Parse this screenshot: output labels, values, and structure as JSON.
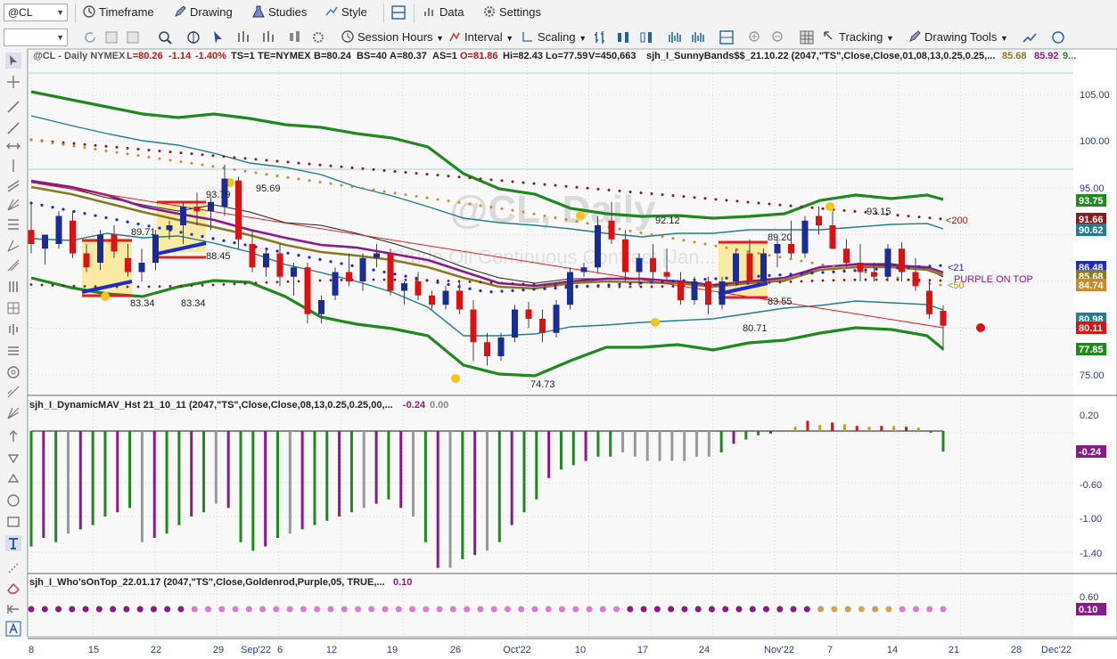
{
  "toolbar1": {
    "symbol": "@CL",
    "timeframe": "Timeframe",
    "drawing": "Drawing",
    "studies": "Studies",
    "style": "Style",
    "data": "Data",
    "settings": "Settings"
  },
  "toolbar2": {
    "session_hours": "Session Hours",
    "interval": "Interval",
    "scaling": "Scaling",
    "tracking": "Tracking",
    "drawing_tools": "Drawing Tools"
  },
  "chart_header": {
    "symbol": "@CL - Daily  NYMEX",
    "last": "L=80.26",
    "change": "-1.14",
    "pct": "-1.40%",
    "ts": "TS=1",
    "te": "TE=NYMEX",
    "bid": "B=80.24",
    "bs": "BS=40",
    "ask": "A=80.37",
    "as": "AS=1",
    "open": "O=81.86",
    "hi": "Hi=82.43",
    "lo": "Lo=77.59",
    "vol": "V=450,663",
    "study": "sjh_I_SunnyBands$$_21.10.22 (2047,\"TS\",Close,Close,01,08,13,0.25,0.25,...",
    "v1": "85.68",
    "v2": "85.92",
    "v3": "9..."
  },
  "watermark": {
    "title": "@CL, Daily",
    "sub": "Crude Oil Continuous Contract [Jan..."
  },
  "panel2_header": {
    "name": "sjh_I_DynamicMAV_Hst 21_10_11 (2047,\"TS\",Close,Close,08,13,0.25,0.25,00,...",
    "v1": "-0.24",
    "v2": "0.00"
  },
  "panel3_header": {
    "name": "sjh_I_Who'sOnTop_22.01.17 (2047,\"TS\",Close,Goldenrod,Purple,05, TRUE,...",
    "v1": "0.10"
  },
  "price_axis_ticks": [
    "105.00",
    "100.00",
    "95.00",
    "75.00"
  ],
  "price_axis_markers": [
    {
      "label": "93.75",
      "color": "#1f8a1f"
    },
    {
      "label": "91.66",
      "color": "#8b1a1a"
    },
    {
      "label": "90.62",
      "color": "#1f7f8a"
    },
    {
      "label": "86.48",
      "color": "#1a2bd6"
    },
    {
      "label": "85.68",
      "color": "#8a7a1f"
    },
    {
      "label": "84.74",
      "color": "#c88a2a"
    },
    {
      "label": "80.98",
      "color": "#1f7f8a"
    },
    {
      "label": "80.11",
      "color": "#e01010"
    },
    {
      "label": "77.85",
      "color": "#1f8a1f"
    }
  ],
  "osc_axis_ticks": [
    "0.20",
    "-0.60",
    "-1.00",
    "-1.40"
  ],
  "osc_axis_marker": {
    "label": "-0.24",
    "color": "#8a1a8a"
  },
  "who_axis_ticks": [
    "0.60"
  ],
  "who_axis_marker": {
    "label": "0.10",
    "color": "#8a1a8a"
  },
  "annotations": {
    "a1": "89.71",
    "a2": "88.45",
    "a3": "93.79",
    "a4": "95.69",
    "a5": "83.34",
    "a6": "83.34",
    "a7": "92.12",
    "a8": "74.73",
    "a9": "89.20",
    "a10": "93.15",
    "a11": "83.55",
    "a12": "80.71",
    "ma200": "<200",
    "ma21": "<21",
    "ma50": "<50",
    "purple": "PURPLE ON TOP"
  },
  "time_axis": [
    "8",
    "15",
    "22",
    "29",
    "Sep'22",
    "6",
    "12",
    "19",
    "26",
    "Oct'22",
    "10",
    "17",
    "24",
    "Nov'22",
    "7",
    "14",
    "21",
    "28",
    "Dec'22"
  ],
  "chart_data": {
    "type": "candlestick",
    "title": "@CL, Daily",
    "ylim": [
      73,
      108
    ],
    "series_ohlc": [
      [
        90.5,
        93.5,
        88.0,
        89.0
      ],
      [
        88.5,
        90.0,
        86.8,
        90.0
      ],
      [
        89.0,
        92.5,
        88.5,
        92.0
      ],
      [
        91.5,
        92.5,
        87.5,
        88.0
      ],
      [
        88.0,
        89.0,
        86.0,
        86.5
      ],
      [
        87.0,
        90.5,
        86.2,
        90.0
      ],
      [
        90.0,
        91.0,
        87.5,
        88.2
      ],
      [
        87.5,
        89.0,
        85.5,
        86.0
      ],
      [
        86.0,
        88.5,
        85.0,
        87.0
      ],
      [
        87.0,
        90.5,
        86.2,
        90.0
      ],
      [
        90.5,
        91.5,
        89.5,
        91.0
      ],
      [
        91.0,
        93.5,
        89.0,
        93.0
      ],
      [
        93.0,
        94.5,
        91.0,
        92.5
      ],
      [
        92.5,
        94.0,
        90.5,
        93.5
      ],
      [
        93.0,
        97.5,
        92.0,
        96.0
      ],
      [
        95.8,
        96.2,
        88.5,
        89.5
      ],
      [
        89.0,
        90.5,
        86.0,
        86.5
      ],
      [
        86.5,
        88.5,
        85.5,
        88.0
      ],
      [
        88.0,
        89.0,
        84.5,
        85.5
      ],
      [
        85.5,
        87.0,
        83.5,
        86.5
      ],
      [
        86.5,
        87.0,
        80.5,
        81.5
      ],
      [
        81.5,
        83.5,
        80.5,
        83.0
      ],
      [
        83.5,
        86.5,
        83.0,
        86.0
      ],
      [
        86.0,
        88.0,
        84.5,
        85.0
      ],
      [
        85.0,
        88.0,
        84.0,
        87.5
      ],
      [
        87.5,
        89.0,
        86.5,
        88.0
      ],
      [
        88.0,
        88.5,
        83.5,
        84.0
      ],
      [
        84.0,
        85.0,
        82.5,
        84.8
      ],
      [
        85.0,
        86.0,
        83.0,
        83.5
      ],
      [
        83.5,
        84.0,
        82.0,
        82.5
      ],
      [
        82.5,
        84.5,
        82.0,
        84.0
      ],
      [
        84.0,
        85.0,
        81.5,
        82.0
      ],
      [
        82.0,
        83.0,
        76.5,
        78.5
      ],
      [
        78.5,
        79.5,
        76.0,
        77.0
      ],
      [
        77.0,
        79.5,
        76.5,
        79.0
      ],
      [
        79.0,
        82.5,
        78.5,
        82.0
      ],
      [
        82.0,
        82.8,
        80.0,
        81.0
      ],
      [
        81.0,
        82.0,
        78.5,
        79.5
      ],
      [
        79.5,
        83.0,
        79.0,
        82.5
      ],
      [
        82.5,
        86.5,
        82.0,
        86.0
      ],
      [
        86.0,
        87.0,
        85.5,
        86.5
      ],
      [
        86.5,
        92.0,
        86.0,
        91.0
      ],
      [
        91.5,
        93.5,
        89.0,
        89.5
      ],
      [
        89.5,
        90.5,
        85.0,
        86.0
      ],
      [
        86.0,
        88.0,
        84.5,
        87.5
      ],
      [
        87.5,
        89.0,
        85.0,
        86.0
      ],
      [
        86.0,
        88.5,
        85.0,
        85.5
      ],
      [
        85.0,
        86.0,
        82.5,
        83.0
      ],
      [
        83.0,
        85.5,
        82.5,
        85.0
      ],
      [
        85.0,
        85.5,
        81.5,
        82.5
      ],
      [
        82.5,
        85.5,
        82.0,
        85.0
      ],
      [
        85.0,
        88.5,
        84.5,
        88.0
      ],
      [
        88.0,
        89.5,
        85.0,
        85.0
      ],
      [
        85.0,
        88.5,
        84.5,
        88.0
      ],
      [
        88.0,
        89.5,
        86.5,
        89.0
      ],
      [
        89.0,
        91.5,
        87.5,
        88.0
      ],
      [
        88.0,
        92.0,
        87.5,
        91.5
      ],
      [
        92.0,
        93.0,
        90.0,
        91.0
      ],
      [
        91.0,
        92.5,
        88.5,
        88.5
      ],
      [
        88.5,
        89.5,
        86.5,
        87.0
      ],
      [
        87.0,
        89.0,
        85.0,
        86.0
      ],
      [
        86.0,
        87.0,
        85.0,
        85.5
      ],
      [
        85.5,
        89.0,
        85.0,
        88.5
      ],
      [
        88.5,
        89.2,
        85.0,
        86.0
      ],
      [
        86.0,
        87.5,
        84.0,
        84.5
      ],
      [
        84.0,
        85.0,
        81.0,
        81.5
      ],
      [
        81.86,
        82.43,
        77.59,
        80.26
      ]
    ],
    "osc_values": [
      -1.35,
      -1.25,
      -1.3,
      -1.2,
      -1.15,
      -1.1,
      -1.0,
      -0.95,
      -0.9,
      -1.3,
      -1.25,
      -1.2,
      -1.1,
      -1.0,
      -0.95,
      -0.85,
      -0.9,
      -1.3,
      -1.4,
      -1.35,
      -1.25,
      -1.2,
      -1.15,
      -1.1,
      -1.05,
      -1.0,
      -0.95,
      -0.9,
      -0.85,
      -0.8,
      -0.9,
      -1.0,
      -1.3,
      -1.6,
      -1.6,
      -1.5,
      -1.45,
      -1.4,
      -1.3,
      -1.1,
      -0.95,
      -0.8,
      -0.55,
      -0.45,
      -0.4,
      -0.35,
      -0.3,
      -0.3,
      -0.25,
      -0.3,
      -0.35,
      -0.35,
      -0.35,
      -0.35,
      -0.3,
      -0.3,
      -0.25,
      -0.15,
      -0.1,
      -0.05,
      -0.03,
      0.0,
      0.05,
      0.12,
      0.07,
      0.1,
      0.08,
      0.06,
      0.05,
      0.06,
      0.06,
      0.05,
      0.04,
      -0.02,
      -0.24
    ],
    "osc_colors_note": "green/purple/gray histogram"
  }
}
